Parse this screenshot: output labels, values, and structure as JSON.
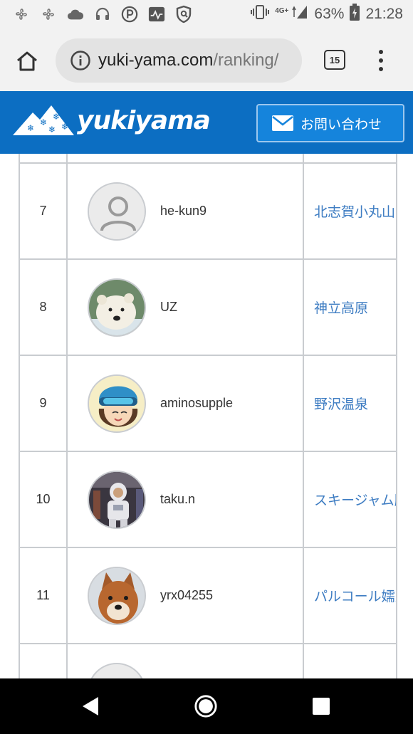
{
  "status_bar": {
    "icons_left": [
      "fan-icon",
      "fan-icon",
      "cloud-icon",
      "headset-icon",
      "parking-icon",
      "activity-icon",
      "shield-icon"
    ],
    "network": "4G+",
    "battery": "63%",
    "time": "21:28"
  },
  "browser": {
    "url_host": "yuki-yama.com",
    "url_path": "/ranking/",
    "tab_count": "15"
  },
  "site": {
    "logo_text": "yukiyama",
    "contact_label": "お問い合わせ"
  },
  "ranking": {
    "rows": [
      {
        "rank": "7",
        "username": "he-kun9",
        "area": "北志賀小丸山",
        "avatar": "default-avatar"
      },
      {
        "rank": "8",
        "username": "UZ",
        "area": "神立高原",
        "avatar": "polar-bear"
      },
      {
        "rank": "9",
        "username": "aminosupple",
        "area": "野沢温泉",
        "avatar": "skier-girl"
      },
      {
        "rank": "10",
        "username": "taku.n",
        "area": "スキージャム勝山",
        "avatar": "astronaut"
      },
      {
        "rank": "11",
        "username": "yrx04255",
        "area": "パルコール嬬恋",
        "avatar": "shiba-dog"
      }
    ]
  }
}
